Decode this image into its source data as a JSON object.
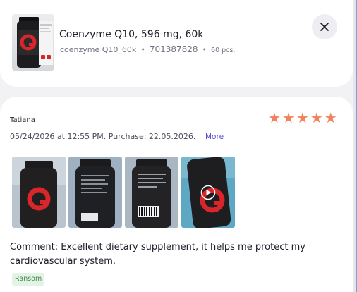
{
  "product": {
    "title": "Coenzyme Q10, 596 mg, 60k",
    "variant": "coenzyme Q10_60k",
    "article": "701387828",
    "quantity": "60 pcs.",
    "separator": "•",
    "thumbnail_icon": "supplement-bottle-icon"
  },
  "close_icon": "close-icon",
  "review": {
    "author": "Tatiana",
    "rating": 5,
    "stars": [
      "★",
      "★",
      "★",
      "★",
      "★"
    ],
    "date_text": "05/24/2026 at 12:55 PM.",
    "purchase_text": "Purchase: 22.05.2026.",
    "more_label": "More",
    "photo_count": 4,
    "video_icon": "play-icon",
    "comment": "Comment: Excellent dietary supplement, it helps me protect my cardiovascular system.",
    "tag": "Ransom"
  },
  "colors": {
    "star": "#f0835c",
    "link": "#5a4fcf",
    "tag_bg": "#e4f3e6",
    "tag_text": "#3f8a4e",
    "bottle_accent": "#d8262b"
  }
}
